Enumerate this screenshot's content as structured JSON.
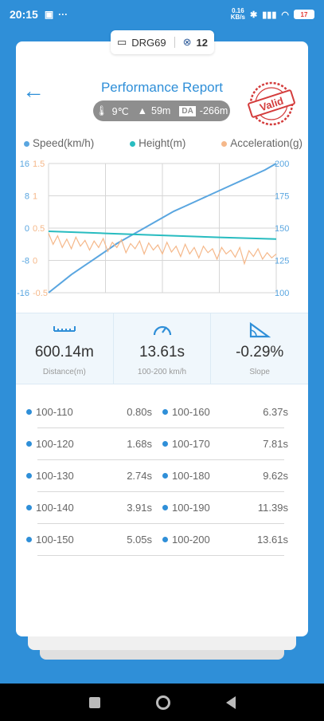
{
  "status": {
    "time": "20:15",
    "net_speed": "0.16",
    "net_unit": "KB/s",
    "battery": "17"
  },
  "device": {
    "name": "DRG69",
    "satellites": "12"
  },
  "header": {
    "title": "Performance Report",
    "stamp_text": "Valid"
  },
  "conditions": {
    "temperature": "9℃",
    "altitude": "59m",
    "da_label": "DA",
    "density_altitude": "-266m"
  },
  "legend": [
    {
      "label": "Speed(km/h)",
      "color": "#5aa6e0"
    },
    {
      "label": "Height(m)",
      "color": "#28bcc0"
    },
    {
      "label": "Acceleration(g)",
      "color": "#f5b88a"
    }
  ],
  "chart_data": {
    "type": "line",
    "axes": {
      "left_outer": {
        "ticks": [
          "16",
          "8",
          "0",
          "-8",
          "-16"
        ],
        "color": "#5aa6e0"
      },
      "left_inner": {
        "ticks": [
          "1.5",
          "1",
          "0.5",
          "0",
          "-0.5"
        ],
        "color": "#f5b88a"
      },
      "right": {
        "ticks": [
          "200",
          "175",
          "150",
          "125",
          "100"
        ],
        "color": "#5aa6e0"
      }
    },
    "grid": true,
    "series": [
      {
        "name": "Speed(km/h)",
        "axis": "right",
        "ylim": [
          100,
          200
        ],
        "color": "#5aa6e0",
        "x": [
          0,
          0.05,
          0.1,
          0.15,
          0.2,
          0.25,
          0.3,
          0.35,
          0.4,
          0.45,
          0.5,
          0.55,
          0.6,
          0.65,
          0.7,
          0.75,
          0.8,
          0.85,
          0.9,
          0.95,
          1.0
        ],
        "values": [
          100,
          107,
          114,
          120,
          126,
          132,
          138,
          143,
          148,
          153,
          158,
          163,
          167,
          171,
          175,
          179,
          183,
          187,
          191,
          195,
          200
        ]
      },
      {
        "name": "Height(m)",
        "axis": "left_outer",
        "ylim": [
          -16,
          16
        ],
        "color": "#28bcc0",
        "x": [
          0,
          0.25,
          0.5,
          0.75,
          1.0
        ],
        "values": [
          -0.8,
          -1.3,
          -1.8,
          -2.3,
          -2.7
        ]
      },
      {
        "name": "Acceleration(g)",
        "axis": "left_inner",
        "ylim": [
          -0.5,
          1.5
        ],
        "color": "#f5b88a",
        "x": [
          0,
          0.02,
          0.04,
          0.06,
          0.08,
          0.1,
          0.12,
          0.14,
          0.16,
          0.18,
          0.2,
          0.22,
          0.24,
          0.26,
          0.28,
          0.3,
          0.32,
          0.34,
          0.36,
          0.38,
          0.4,
          0.42,
          0.44,
          0.46,
          0.48,
          0.5,
          0.52,
          0.54,
          0.56,
          0.58,
          0.6,
          0.62,
          0.64,
          0.66,
          0.68,
          0.7,
          0.72,
          0.74,
          0.76,
          0.78,
          0.8,
          0.82,
          0.84,
          0.86,
          0.88,
          0.9,
          0.92,
          0.94,
          0.96,
          0.98,
          1.0
        ],
        "values": [
          0.42,
          0.25,
          0.38,
          0.2,
          0.33,
          0.18,
          0.36,
          0.22,
          0.31,
          0.16,
          0.3,
          0.2,
          0.34,
          0.14,
          0.28,
          0.2,
          0.32,
          0.12,
          0.26,
          0.18,
          0.3,
          0.1,
          0.27,
          0.16,
          0.24,
          0.1,
          0.28,
          0.13,
          0.22,
          0.06,
          0.25,
          0.1,
          0.2,
          0.04,
          0.22,
          0.12,
          0.18,
          0.02,
          0.2,
          0.1,
          0.16,
          0.05,
          0.2,
          -0.05,
          0.15,
          0.06,
          0.18,
          0.02,
          0.12,
          0.04,
          0.1
        ]
      }
    ]
  },
  "stats": [
    {
      "value": "600.14m",
      "label": "Distance(m)",
      "icon": "ruler-icon"
    },
    {
      "value": "13.61s",
      "label": "100-200 km/h",
      "icon": "speedometer-icon"
    },
    {
      "value": "-0.29%",
      "label": "Slope",
      "icon": "slope-icon"
    }
  ],
  "splits_left": [
    {
      "range": "100-110",
      "time": "0.80s"
    },
    {
      "range": "100-120",
      "time": "1.68s"
    },
    {
      "range": "100-130",
      "time": "2.74s"
    },
    {
      "range": "100-140",
      "time": "3.91s"
    },
    {
      "range": "100-150",
      "time": "5.05s"
    }
  ],
  "splits_right": [
    {
      "range": "100-160",
      "time": "6.37s"
    },
    {
      "range": "100-170",
      "time": "7.81s"
    },
    {
      "range": "100-180",
      "time": "9.62s"
    },
    {
      "range": "100-190",
      "time": "11.39s"
    },
    {
      "range": "100-200",
      "time": "13.61s"
    }
  ]
}
